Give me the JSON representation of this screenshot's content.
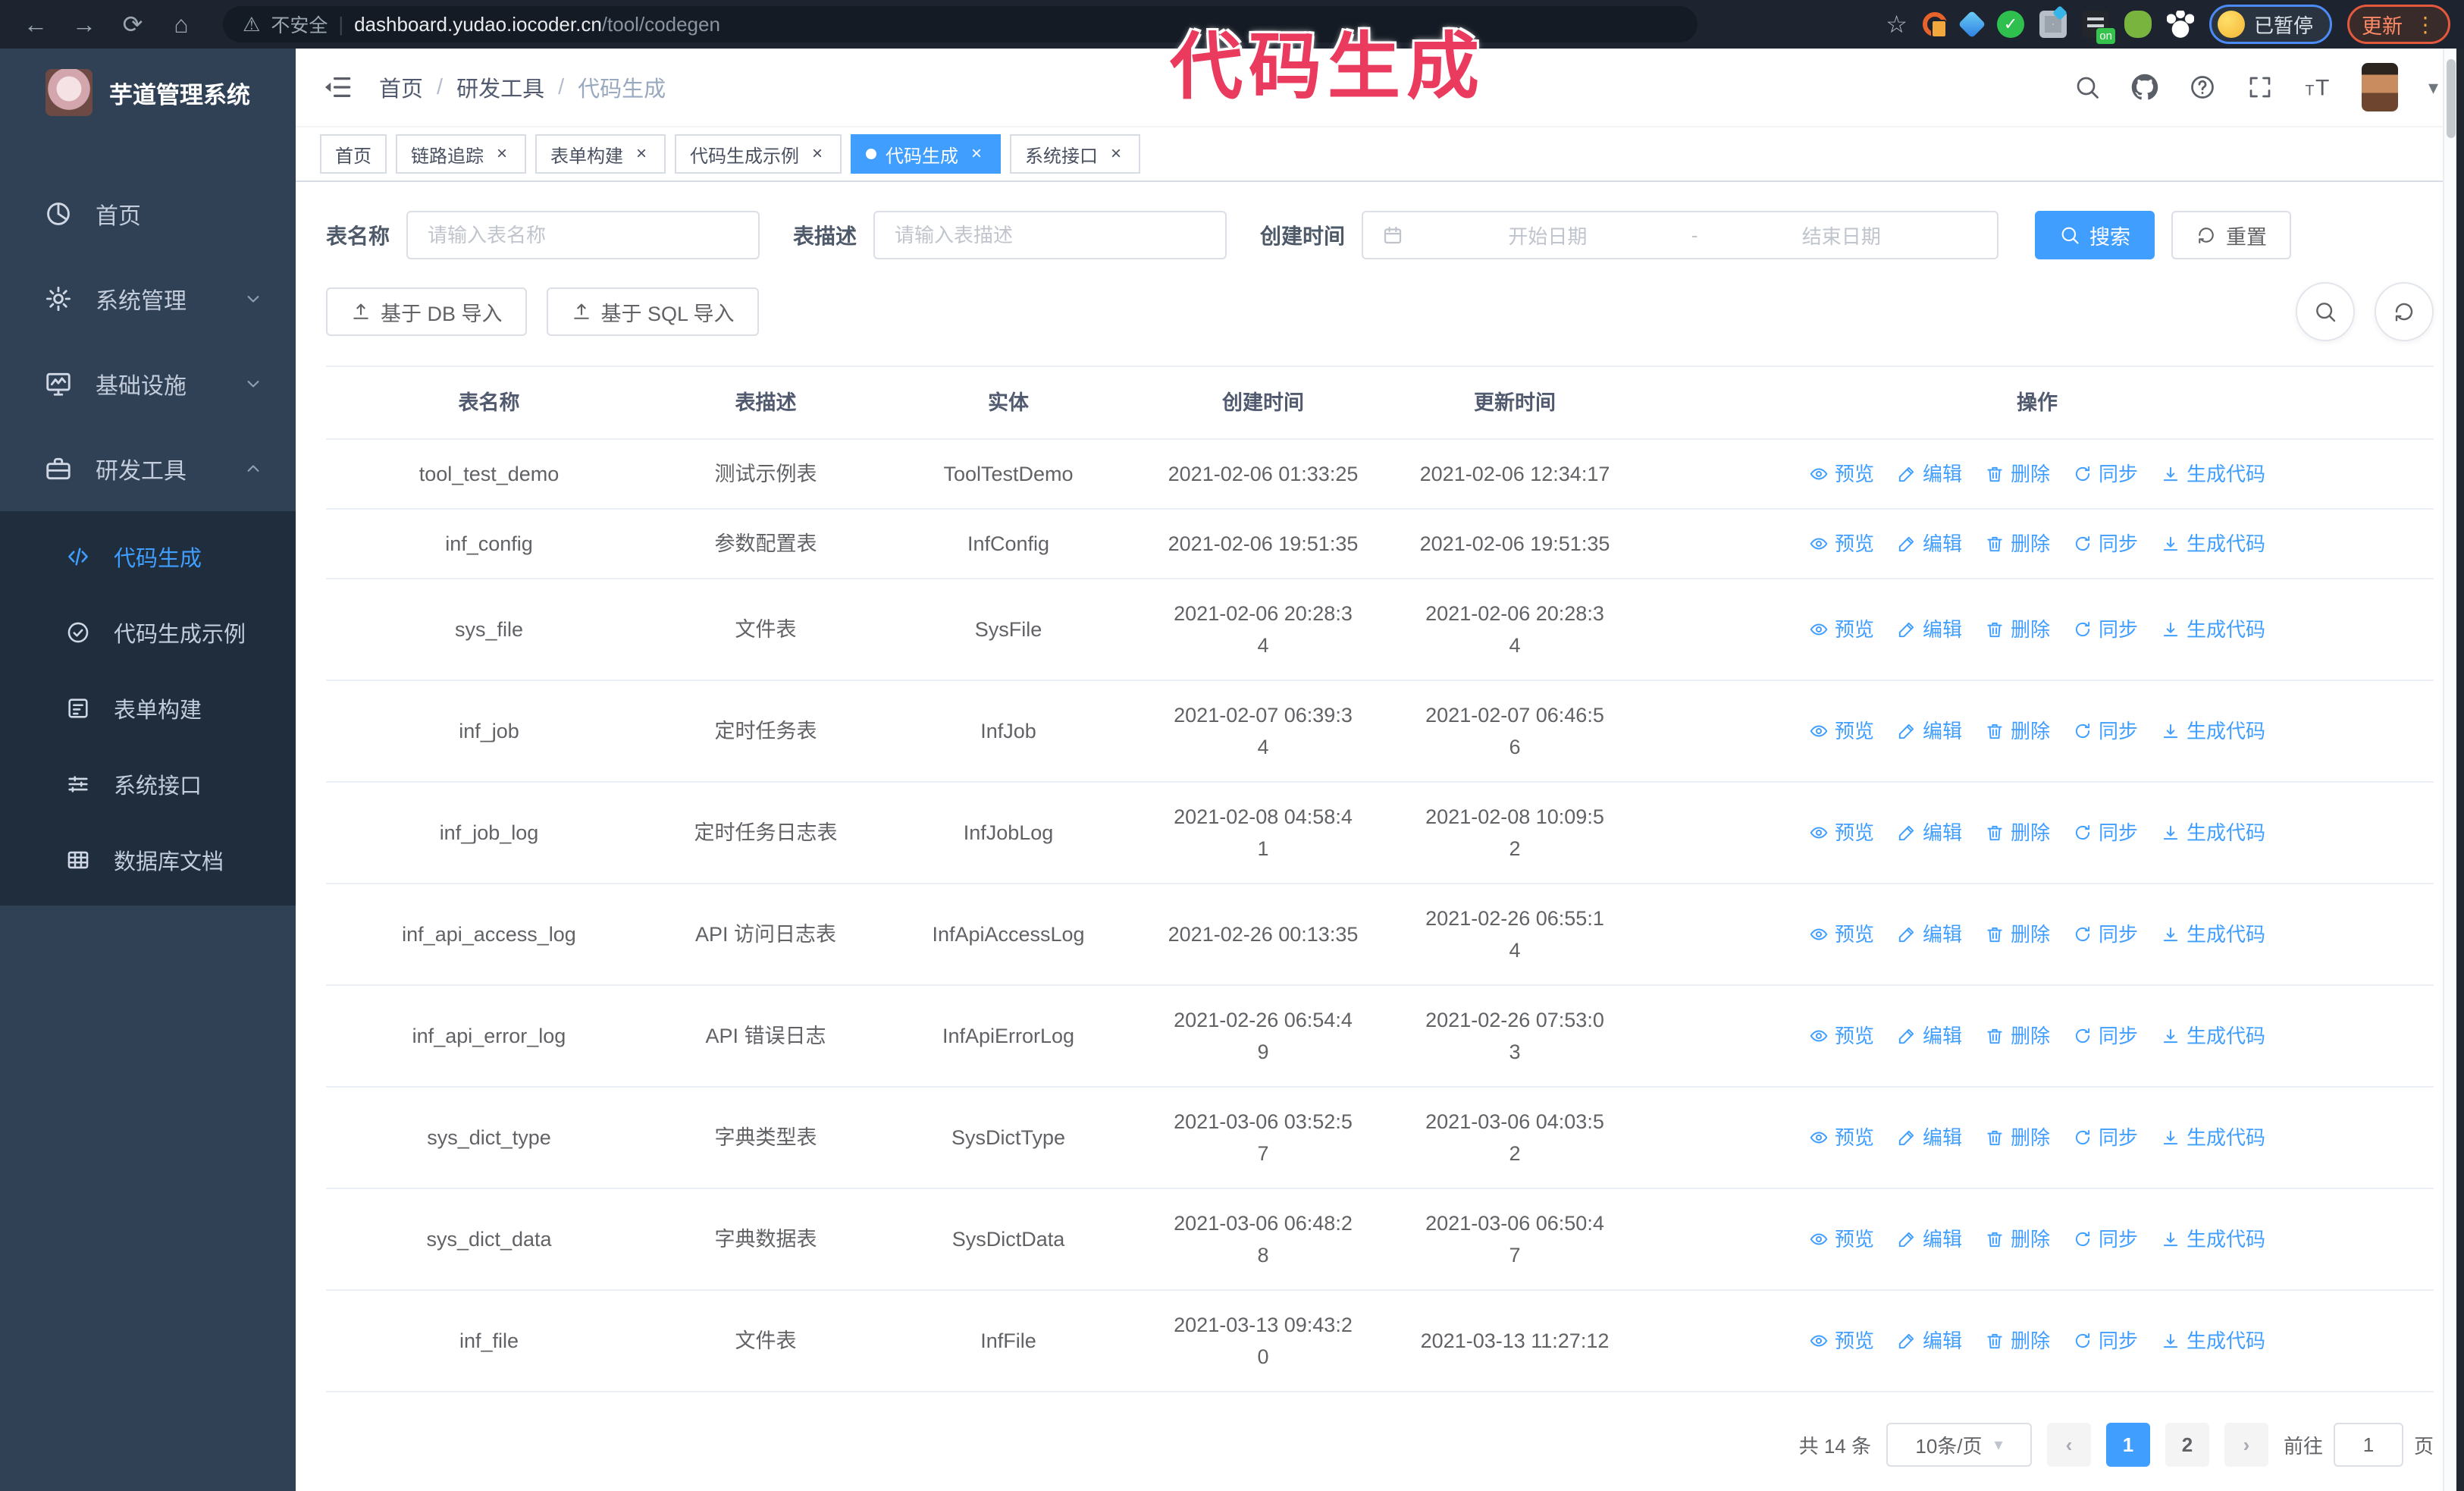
{
  "browser": {
    "security_label": "不安全",
    "url_divider": "|",
    "url_domain": "dashboard.yudao.iocoder.cn",
    "url_path": "/tool/codegen",
    "paused_badge": "已暂停",
    "update_button": "更新"
  },
  "icons": {
    "back": "←",
    "forward": "→",
    "reload": "⟳",
    "home": "⌂",
    "warning": "⚠",
    "star": "☆",
    "kebab": "⋮",
    "caret": "▾",
    "check": "✓"
  },
  "annotation": "代码生成",
  "sidebar": {
    "title": "芋道管理系统",
    "items": [
      {
        "label": "首页",
        "icon": "dashboard",
        "expandable": false,
        "expanded": false,
        "active": false
      },
      {
        "label": "系统管理",
        "icon": "gear",
        "expandable": true,
        "expanded": false,
        "active": false
      },
      {
        "label": "基础设施",
        "icon": "monitor",
        "expandable": true,
        "expanded": false,
        "active": false
      },
      {
        "label": "研发工具",
        "icon": "toolbox",
        "expandable": true,
        "expanded": true,
        "active": false
      }
    ],
    "subitems": [
      {
        "label": "代码生成",
        "icon": "code",
        "active": true
      },
      {
        "label": "代码生成示例",
        "icon": "badge",
        "active": false
      },
      {
        "label": "表单构建",
        "icon": "form",
        "active": false
      },
      {
        "label": "系统接口",
        "icon": "sliders",
        "active": false
      },
      {
        "label": "数据库文档",
        "icon": "database",
        "active": false
      }
    ]
  },
  "header": {
    "breadcrumb": [
      "首页",
      "研发工具",
      "代码生成"
    ],
    "separator": "/"
  },
  "ui": {
    "close_glyph": "×"
  },
  "tabs": [
    {
      "label": "首页",
      "closable": false,
      "active": false
    },
    {
      "label": "链路追踪",
      "closable": true,
      "active": false
    },
    {
      "label": "表单构建",
      "closable": true,
      "active": false
    },
    {
      "label": "代码生成示例",
      "closable": true,
      "active": false
    },
    {
      "label": "代码生成",
      "closable": true,
      "active": true
    },
    {
      "label": "系统接口",
      "closable": true,
      "active": false
    }
  ],
  "search": {
    "name_label": "表名称",
    "name_placeholder": "请输入表名称",
    "desc_label": "表描述",
    "desc_placeholder": "请输入表描述",
    "time_label": "创建时间",
    "start_placeholder": "开始日期",
    "range_separator": "-",
    "end_placeholder": "结束日期",
    "search_button": "搜索",
    "reset_button": "重置"
  },
  "toolbar": {
    "import_db_button": "基于 DB 导入",
    "import_sql_button": "基于 SQL 导入"
  },
  "table": {
    "columns": [
      "表名称",
      "表描述",
      "实体",
      "创建时间",
      "更新时间",
      "操作"
    ],
    "actions": [
      {
        "label": "预览",
        "icon": "eye"
      },
      {
        "label": "编辑",
        "icon": "edit"
      },
      {
        "label": "删除",
        "icon": "delete"
      },
      {
        "label": "同步",
        "icon": "sync"
      },
      {
        "label": "生成代码",
        "icon": "download"
      }
    ],
    "rows": [
      {
        "name": "tool_test_demo",
        "desc": "测试示例表",
        "entity": "ToolTestDemo",
        "created": "2021-02-06 01:33:25",
        "updated": "2021-02-06 12:34:17"
      },
      {
        "name": "inf_config",
        "desc": "参数配置表",
        "entity": "InfConfig",
        "created": "2021-02-06 19:51:35",
        "updated": "2021-02-06 19:51:35"
      },
      {
        "name": "sys_file",
        "desc": "文件表",
        "entity": "SysFile",
        "created": "2021-02-06 20:28:3\n4",
        "updated": "2021-02-06 20:28:3\n4"
      },
      {
        "name": "inf_job",
        "desc": "定时任务表",
        "entity": "InfJob",
        "created": "2021-02-07 06:39:3\n4",
        "updated": "2021-02-07 06:46:5\n6"
      },
      {
        "name": "inf_job_log",
        "desc": "定时任务日志表",
        "entity": "InfJobLog",
        "created": "2021-02-08 04:58:4\n1",
        "updated": "2021-02-08 10:09:5\n2"
      },
      {
        "name": "inf_api_access_log",
        "desc": "API 访问日志表",
        "entity": "InfApiAccessLog",
        "created": "2021-02-26 00:13:35",
        "updated": "2021-02-26 06:55:1\n4"
      },
      {
        "name": "inf_api_error_log",
        "desc": "API 错误日志",
        "entity": "InfApiErrorLog",
        "created": "2021-02-26 06:54:4\n9",
        "updated": "2021-02-26 07:53:0\n3"
      },
      {
        "name": "sys_dict_type",
        "desc": "字典类型表",
        "entity": "SysDictType",
        "created": "2021-03-06 03:52:5\n7",
        "updated": "2021-03-06 04:03:5\n2"
      },
      {
        "name": "sys_dict_data",
        "desc": "字典数据表",
        "entity": "SysDictData",
        "created": "2021-03-06 06:48:2\n8",
        "updated": "2021-03-06 06:50:4\n7"
      },
      {
        "name": "inf_file",
        "desc": "文件表",
        "entity": "InfFile",
        "created": "2021-03-13 09:43:2\n0",
        "updated": "2021-03-13 11:27:12"
      }
    ]
  },
  "pagination": {
    "total": "共 14 条",
    "page_size": "10条/页",
    "prev_glyph": "‹",
    "next_glyph": "›",
    "pages": [
      "1",
      "2"
    ],
    "active_page": "1",
    "goto_label": "前往",
    "goto_value": "1",
    "page_suffix": "页"
  },
  "colors": {
    "accent": "#409EFF",
    "annotation_pink": "#ea3a5e",
    "sidebar_bg": "#304156",
    "submenu_bg": "#1f2d3d",
    "browser_bar_bg": "#1d242f"
  }
}
